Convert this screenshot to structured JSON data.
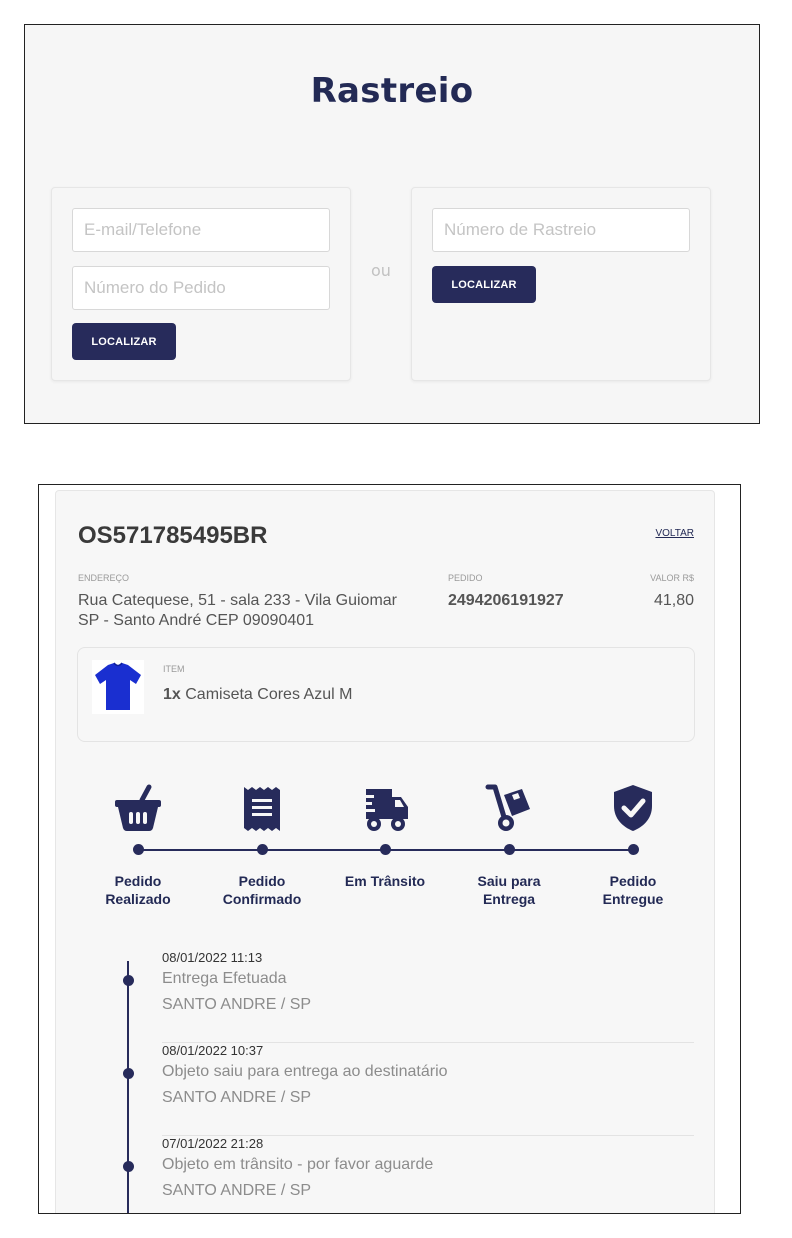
{
  "search": {
    "title": "Rastreio",
    "email_placeholder": "E-mail/Telefone",
    "order_placeholder": "Número do Pedido",
    "locate_button": "LOCALIZAR",
    "or_label": "ou",
    "tracking_placeholder": "Número de Rastreio",
    "locate_button_2": "LOCALIZAR"
  },
  "result": {
    "tracking_code": "OS571785495BR",
    "back_link": "VOLTAR",
    "address_label": "ENDEREÇO",
    "address_line1": "Rua Catequese, 51 - sala 233 - Vila Guiomar",
    "address_line2": "SP - Santo André CEP 09090401",
    "order_label": "PEDIDO",
    "order_number": "2494206191927",
    "value_label": "VALOR R$",
    "value": "41,80",
    "item_label": "ITEM",
    "item_qty": "1x",
    "item_name": "Camiseta Cores Azul M",
    "item_color": "#1a2fd0"
  },
  "steps": [
    {
      "icon": "basket-icon",
      "line1": "Pedido",
      "line2": "Realizado"
    },
    {
      "icon": "receipt-icon",
      "line1": "Pedido",
      "line2": "Confirmado"
    },
    {
      "icon": "truck-fast-icon",
      "line1": "Em Trânsito",
      "line2": ""
    },
    {
      "icon": "dolly-icon",
      "line1": "Saiu para",
      "line2": "Entrega"
    },
    {
      "icon": "shield-check-icon",
      "line1": "Pedido",
      "line2": "Entregue"
    }
  ],
  "events": [
    {
      "date": "08/01/2022 11:13",
      "status": "Entrega Efetuada",
      "location": "SANTO ANDRE / SP"
    },
    {
      "date": "08/01/2022 10:37",
      "status": "Objeto saiu para entrega ao destinatário",
      "location": "SANTO ANDRE / SP"
    },
    {
      "date": "07/01/2022 21:28",
      "status": "Objeto em trânsito - por favor aguarde",
      "location": "SANTO ANDRE / SP"
    }
  ],
  "colors": {
    "primary": "#272b5b",
    "title": "#232a55",
    "background": "#f6f6f6"
  }
}
